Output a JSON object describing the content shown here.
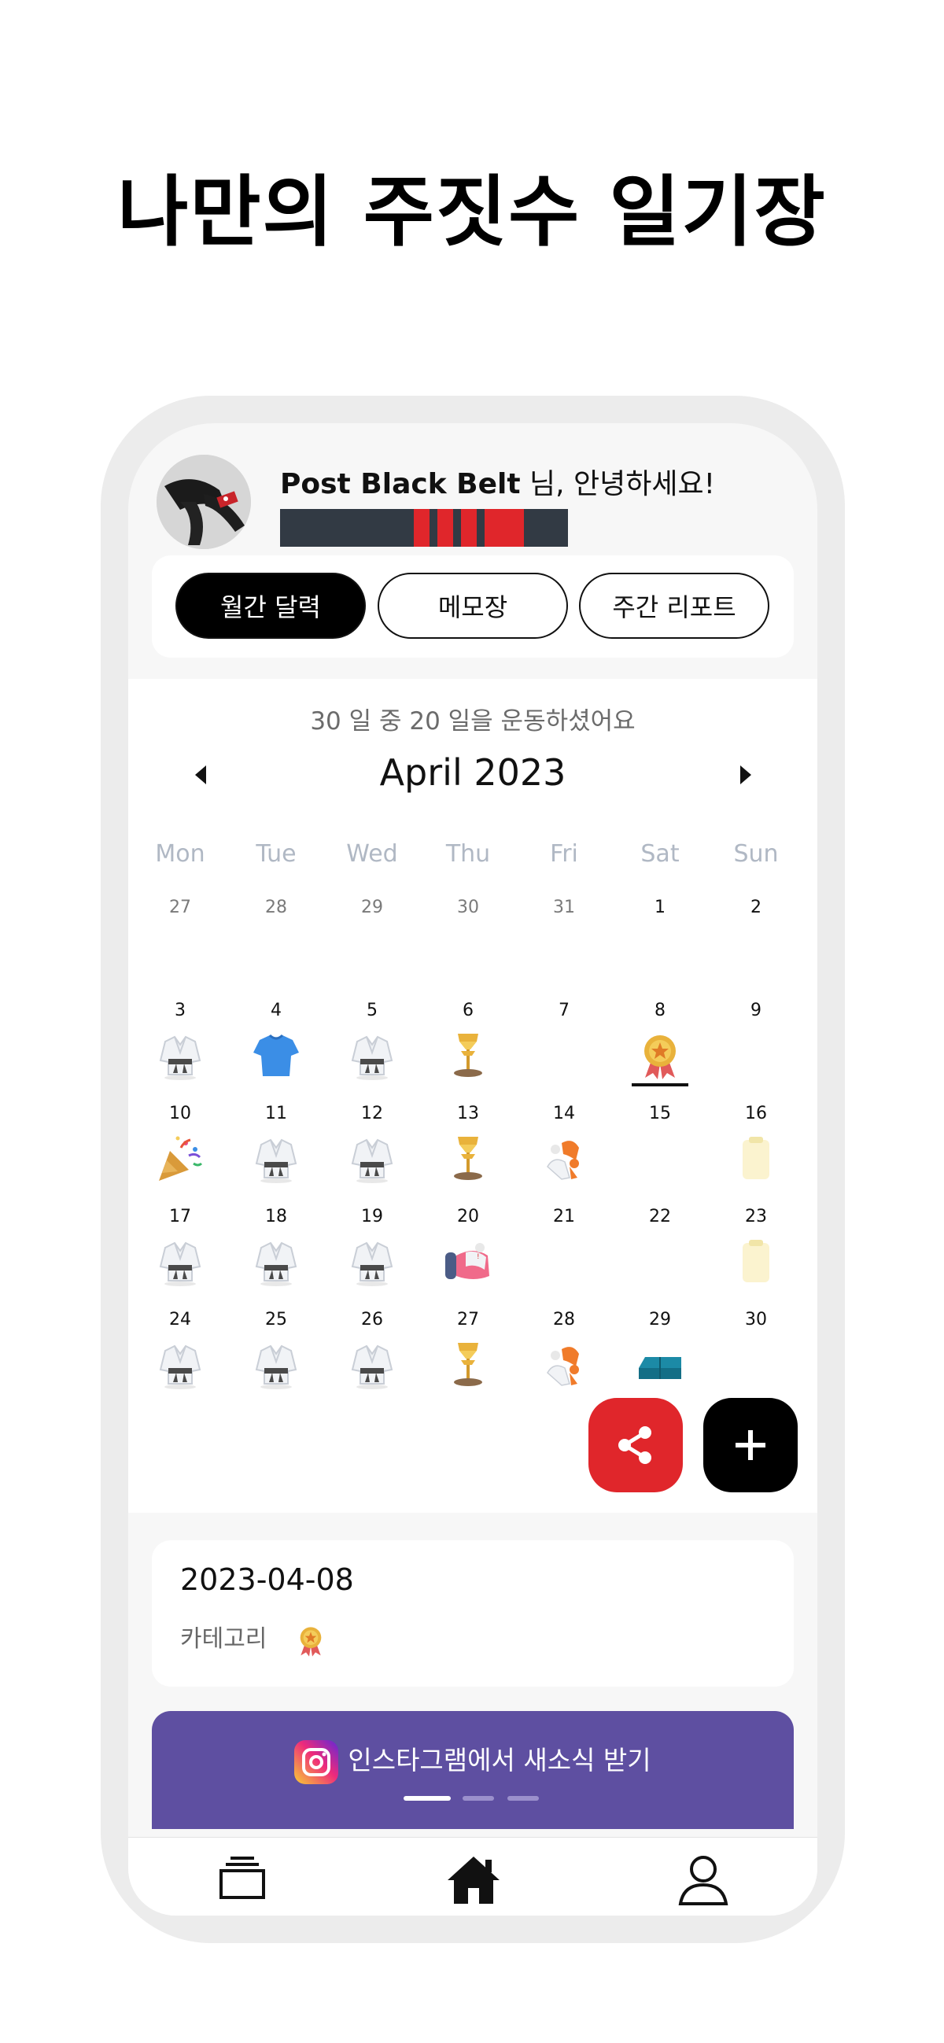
{
  "headline": "나만의 주짓수 일기장",
  "profile": {
    "name": "Post Black Belt",
    "greeting": " 님, 안녕하세요!",
    "belt": {
      "color": "black",
      "stripes": 3
    }
  },
  "tabs": [
    {
      "label": "월간 달력",
      "active": true
    },
    {
      "label": "메모장",
      "active": false
    },
    {
      "label": "주간 리포트",
      "active": false
    }
  ],
  "calendar": {
    "summary": "30 일 중 20 일을 운동하셨어요",
    "month_label": "April 2023",
    "weekdays": [
      "Mon",
      "Tue",
      "Wed",
      "Thu",
      "Fri",
      "Sat",
      "Sun"
    ],
    "weeks": [
      [
        {
          "d": "27",
          "muted": true,
          "icon": ""
        },
        {
          "d": "28",
          "muted": true,
          "icon": ""
        },
        {
          "d": "29",
          "muted": true,
          "icon": ""
        },
        {
          "d": "30",
          "muted": true,
          "icon": ""
        },
        {
          "d": "31",
          "muted": true,
          "icon": ""
        },
        {
          "d": "1",
          "muted": false,
          "icon": ""
        },
        {
          "d": "2",
          "muted": false,
          "icon": ""
        }
      ],
      [
        {
          "d": "3",
          "muted": false,
          "icon": "gi-icon"
        },
        {
          "d": "4",
          "muted": false,
          "icon": "tshirt-icon"
        },
        {
          "d": "5",
          "muted": false,
          "icon": "gi-icon"
        },
        {
          "d": "6",
          "muted": false,
          "icon": "trophy-icon"
        },
        {
          "d": "7",
          "muted": false,
          "icon": ""
        },
        {
          "d": "8",
          "muted": false,
          "icon": "medal-icon",
          "selected": true
        },
        {
          "d": "9",
          "muted": false,
          "icon": ""
        }
      ],
      [
        {
          "d": "10",
          "muted": false,
          "icon": "party-popper-icon"
        },
        {
          "d": "11",
          "muted": false,
          "icon": "gi-icon"
        },
        {
          "d": "12",
          "muted": false,
          "icon": "gi-icon"
        },
        {
          "d": "13",
          "muted": false,
          "icon": "trophy-icon"
        },
        {
          "d": "14",
          "muted": false,
          "icon": "takedown-icon"
        },
        {
          "d": "15",
          "muted": false,
          "icon": ""
        },
        {
          "d": "16",
          "muted": false,
          "icon": "note-icon"
        }
      ],
      [
        {
          "d": "17",
          "muted": false,
          "icon": "gi-icon"
        },
        {
          "d": "18",
          "muted": false,
          "icon": "gi-icon"
        },
        {
          "d": "19",
          "muted": false,
          "icon": "gi-icon"
        },
        {
          "d": "20",
          "muted": false,
          "icon": "grappling-icon"
        },
        {
          "d": "21",
          "muted": false,
          "icon": ""
        },
        {
          "d": "22",
          "muted": false,
          "icon": ""
        },
        {
          "d": "23",
          "muted": false,
          "icon": "note-icon"
        }
      ],
      [
        {
          "d": "24",
          "muted": false,
          "icon": "gi-icon"
        },
        {
          "d": "25",
          "muted": false,
          "icon": "gi-icon"
        },
        {
          "d": "26",
          "muted": false,
          "icon": "gi-icon"
        },
        {
          "d": "27",
          "muted": false,
          "icon": "trophy-icon"
        },
        {
          "d": "28",
          "muted": false,
          "icon": "takedown-icon"
        },
        {
          "d": "29",
          "muted": false,
          "icon": "mat-icon"
        },
        {
          "d": "30",
          "muted": false,
          "icon": ""
        }
      ]
    ]
  },
  "detail": {
    "date": "2023-04-08",
    "category_label": "카테고리",
    "category_icon": "medal-icon"
  },
  "banner": {
    "text": "인스타그램에서 새소식 받기",
    "color": "#5e4fa1",
    "page_count": 3,
    "active_page": 1
  },
  "colors": {
    "accent_red": "#e0262b",
    "belt_black": "#323a44"
  },
  "nav": [
    {
      "icon": "cards-icon"
    },
    {
      "icon": "home-icon"
    },
    {
      "icon": "profile-icon"
    }
  ]
}
